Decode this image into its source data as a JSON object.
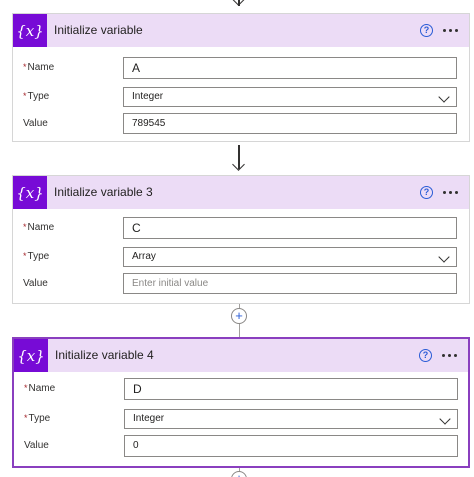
{
  "cards": [
    {
      "icon_text": "{x}",
      "title": "Initialize variable",
      "help_label": "?",
      "fields": {
        "name_label": "Name",
        "name_value": "A",
        "type_label": "Type",
        "type_value": "Integer",
        "value_label": "Value",
        "value_value": "789545",
        "value_placeholder": ""
      }
    },
    {
      "icon_text": "{x}",
      "title": "Initialize variable 3",
      "help_label": "?",
      "fields": {
        "name_label": "Name",
        "name_value": "C",
        "type_label": "Type",
        "type_value": "Array",
        "value_label": "Value",
        "value_value": "",
        "value_placeholder": "Enter initial value"
      }
    },
    {
      "icon_text": "{x}",
      "title": "Initialize variable 4",
      "help_label": "?",
      "fields": {
        "name_label": "Name",
        "name_value": "D",
        "type_label": "Type",
        "type_value": "Integer",
        "value_label": "Value",
        "value_value": "0",
        "value_placeholder": ""
      }
    }
  ],
  "required_marker": "*",
  "add_step_label": "+",
  "colors": {
    "header_bg": "#ecdcf6",
    "icon_bg": "#770bd6",
    "selected_border": "#8a3fbf",
    "help_blue": "#2a5cd6",
    "required_red": "#a4262c"
  }
}
